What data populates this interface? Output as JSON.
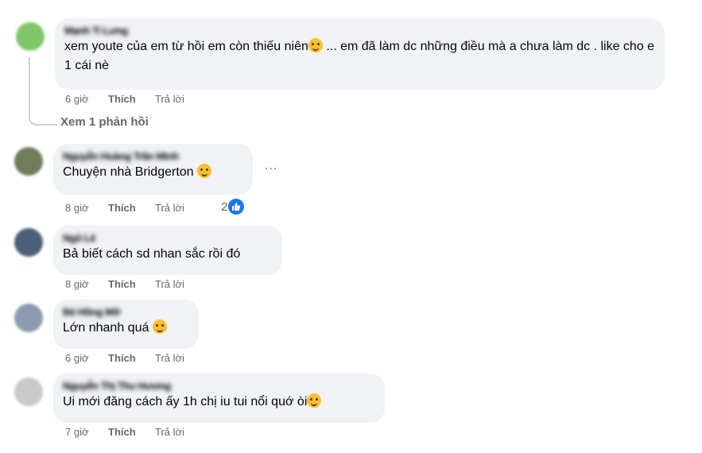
{
  "comments": [
    {
      "author": "Mạnh Ti Lưng",
      "text": "xem youte của em từ hồi em còn thiếu niên",
      "text_after_emoji": " ... em đã làm dc những điều mà a chưa làm dc . like cho e 1 cái nè",
      "time": "6 giờ",
      "like": "Thích",
      "reply": "Trả lời",
      "avatar_color": "#7ec86a"
    },
    {
      "author": "Nguyễn Hoàng Trần Minh",
      "text": "Chuyện nhà Bridgerton",
      "time": "8 giờ",
      "like": "Thích",
      "reply": "Trả lời",
      "reaction_count": "2",
      "avatar_color": "#6f7d5a"
    },
    {
      "author": "Ngô Lê",
      "text": "Bả biết cách sd nhan sắc rồi đó",
      "time": "8 giờ",
      "like": "Thích",
      "reply": "Trả lời",
      "avatar_color": "#4d6079"
    },
    {
      "author": "Bé Hồng Mỡ",
      "text": "Lớn nhanh quá",
      "time": "6 giờ",
      "like": "Thích",
      "reply": "Trả lời",
      "avatar_color": "#8a9bb0"
    },
    {
      "author": "Nguyễn Thị Thu Hương",
      "text": "Ui mới đăng cách ấy 1h chị iu tui nổi quớ òi",
      "time": "7 giờ",
      "like": "Thích",
      "reply": "Trả lời",
      "avatar_color": "#c9c9c9"
    }
  ],
  "view_replies": "Xem 1 phản hồi",
  "more_label": "...",
  "icons": {
    "more": "more-options-icon",
    "like_reaction": "like-reaction-icon",
    "emoji": "emoji-icon"
  }
}
